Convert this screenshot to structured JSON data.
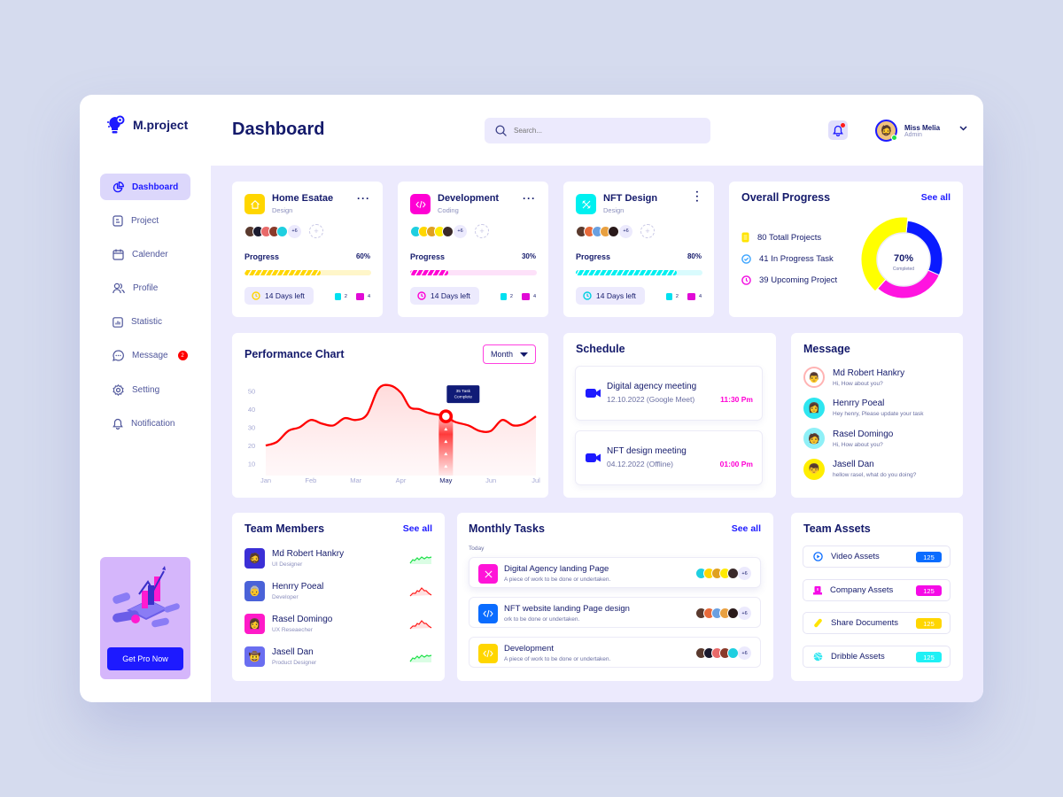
{
  "app": {
    "name": "M.project",
    "page_title": "Dashboard"
  },
  "search": {
    "placeholder": "Search..."
  },
  "user": {
    "name": "Miss Melia",
    "role": "Admin"
  },
  "colors": {
    "accent": "#1d1aff",
    "navy": "#141a6b",
    "yellow": "#ffd600",
    "magenta": "#ff00d4",
    "cyan": "#00f0f0",
    "red": "#ff0000",
    "green": "#1fe04a"
  },
  "sidebar": {
    "items": [
      {
        "label": "Dashboard",
        "icon": "pie-chart-icon",
        "active": true
      },
      {
        "label": "Project",
        "icon": "document-icon"
      },
      {
        "label": "Calender",
        "icon": "calendar-icon"
      },
      {
        "label": "Profile",
        "icon": "users-icon"
      },
      {
        "label": "Statistic",
        "icon": "bar-chart-icon"
      },
      {
        "label": "Message",
        "icon": "chat-icon",
        "badge": "2"
      },
      {
        "label": "Setting",
        "icon": "gear-icon"
      },
      {
        "label": "Notification",
        "icon": "bell-icon"
      }
    ],
    "promo": {
      "button": "Get Pro Now"
    }
  },
  "projects": [
    {
      "title": "Home Esatae",
      "category": "Design",
      "icon": "home-icon",
      "color": "#ffd600",
      "track": "#fff6c9",
      "more_members": "+6",
      "progress_label": "Progress",
      "progress": 60,
      "progress_text": "60%",
      "days_left": "14 Days left",
      "files": "2",
      "comments": "4"
    },
    {
      "title": "Development",
      "category": "Coding",
      "icon": "code-icon",
      "color": "#ff00d4",
      "track": "#fde1f9",
      "more_members": "+6",
      "progress_label": "Progress",
      "progress": 30,
      "progress_text": "30%",
      "days_left": "14 Days left",
      "files": "2",
      "comments": "4"
    },
    {
      "title": "NFT Design",
      "category": "Design",
      "icon": "tools-icon",
      "color": "#00f0f0",
      "track": "#d9fbfd",
      "more_members": "+6",
      "progress_label": "Progress",
      "progress": 80,
      "progress_text": "80%",
      "days_left": "14 Days left",
      "files": "2",
      "comments": "4"
    }
  ],
  "overall": {
    "title": "Overall Progress",
    "see_all": "See all",
    "items": [
      {
        "label": "80 Totall Projects",
        "icon": "clipboard-icon"
      },
      {
        "label": "41 In Progress Task",
        "icon": "check-circle-icon"
      },
      {
        "label": "39 Upcoming Project",
        "icon": "clock-icon"
      }
    ],
    "center_value": "70%",
    "center_label": "Completed",
    "segments": [
      {
        "name": "Totall Projects",
        "value": 40,
        "color": "#ffff00"
      },
      {
        "name": "In Progress Task",
        "value": 30,
        "color": "#0a1aff"
      },
      {
        "name": "Upcoming Project",
        "value": 30,
        "color": "#ff14e0"
      }
    ]
  },
  "performance": {
    "title": "Performance Chart",
    "filter": "Month",
    "tooltip_line1": "35 Task",
    "tooltip_line2": "Complete",
    "chart_data": {
      "type": "line",
      "title": "Performance Chart",
      "categories": [
        "Jan",
        "Feb",
        "Mar",
        "Apr",
        "May",
        "Jun",
        "Jul"
      ],
      "yticks": [
        10,
        20,
        30,
        40,
        50
      ],
      "ylim": [
        5,
        55
      ],
      "highlight": "May",
      "x": [
        0,
        0.25,
        0.5,
        0.75,
        1,
        1.25,
        1.5,
        1.75,
        2,
        2.25,
        2.5,
        2.75,
        3,
        3.2,
        3.4,
        3.6,
        3.8,
        4,
        4.2,
        4.5,
        4.75,
        5,
        5.25,
        5.5,
        5.75,
        6
      ],
      "values": [
        20,
        22,
        28,
        30,
        34,
        32,
        31,
        35,
        34,
        37,
        51,
        53,
        49,
        41,
        40,
        38,
        37,
        36,
        33,
        31,
        28,
        28,
        34,
        31,
        32,
        36
      ]
    }
  },
  "schedule": {
    "title": "Schedule",
    "items": [
      {
        "title": "Digital agency meeting",
        "date": "12.10.2022 (Google Meet)",
        "time": "11:30 Pm"
      },
      {
        "title": "NFT design meeting",
        "date": "04.12.2022 (Offline)",
        "time": "01:00 Pm"
      }
    ]
  },
  "messages": {
    "title": "Message",
    "items": [
      {
        "name": "Md Robert Hankry",
        "text": "Hi, How about you?",
        "ring": "#ffb3b3"
      },
      {
        "name": "Henrry Poeal",
        "text": "Hey henry, Please update your task",
        "ring": "#2ee6f0"
      },
      {
        "name": "Rasel Domingo",
        "text": "Hi, How about you?",
        "ring": "#8ff0f7"
      },
      {
        "name": "Jasell Dan",
        "text": "hellow rasel, what do you doing?",
        "ring": "#ffee00"
      }
    ]
  },
  "team": {
    "title": "Team Members",
    "see_all": "See all",
    "members": [
      {
        "name": "Md Robert Hankry",
        "role": "UI Designer",
        "bg": "#3b2fd6",
        "trend": "up"
      },
      {
        "name": "Henrry Poeal",
        "role": "Developer",
        "bg": "#4a62d8",
        "trend": "down"
      },
      {
        "name": "Rasel Domingo",
        "role": "UX Reseaecher",
        "bg": "#ff1ac8",
        "trend": "down"
      },
      {
        "name": "Jasell Dan",
        "role": "Product Designer",
        "bg": "#6a6ef0",
        "trend": "up"
      }
    ]
  },
  "tasks": {
    "title": "Monthly Tasks",
    "see_all": "See all",
    "group": "Today",
    "items": [
      {
        "title": "Digital Agency landing Page",
        "desc": "A piece of work to be done or undertaken.",
        "color": "#ff14d8",
        "more": "+6",
        "icon": "tools-icon"
      },
      {
        "title": "NFT website landing Page design",
        "desc": "ork to be done or undertaken.",
        "color": "#0a6cff",
        "more": "+6",
        "icon": "code-icon"
      },
      {
        "title": "Development",
        "desc": "A piece of work to be done or undertaken.",
        "color": "#ffd600",
        "more": "+6",
        "icon": "code-icon"
      }
    ]
  },
  "assets": {
    "title": "Team Assets",
    "items": [
      {
        "label": "Video Assets",
        "count": "125",
        "color": "#0a6cff",
        "icon": "play-circle-icon"
      },
      {
        "label": "Company Assets",
        "count": "125",
        "color": "#f50ae6",
        "icon": "building-icon"
      },
      {
        "label": "Share Documents",
        "count": "125",
        "color": "#ffd600",
        "icon": "paperclip-icon"
      },
      {
        "label": "Dribble Assets",
        "count": "125",
        "color": "#1ff0f5",
        "icon": "dribbble-icon"
      }
    ]
  }
}
